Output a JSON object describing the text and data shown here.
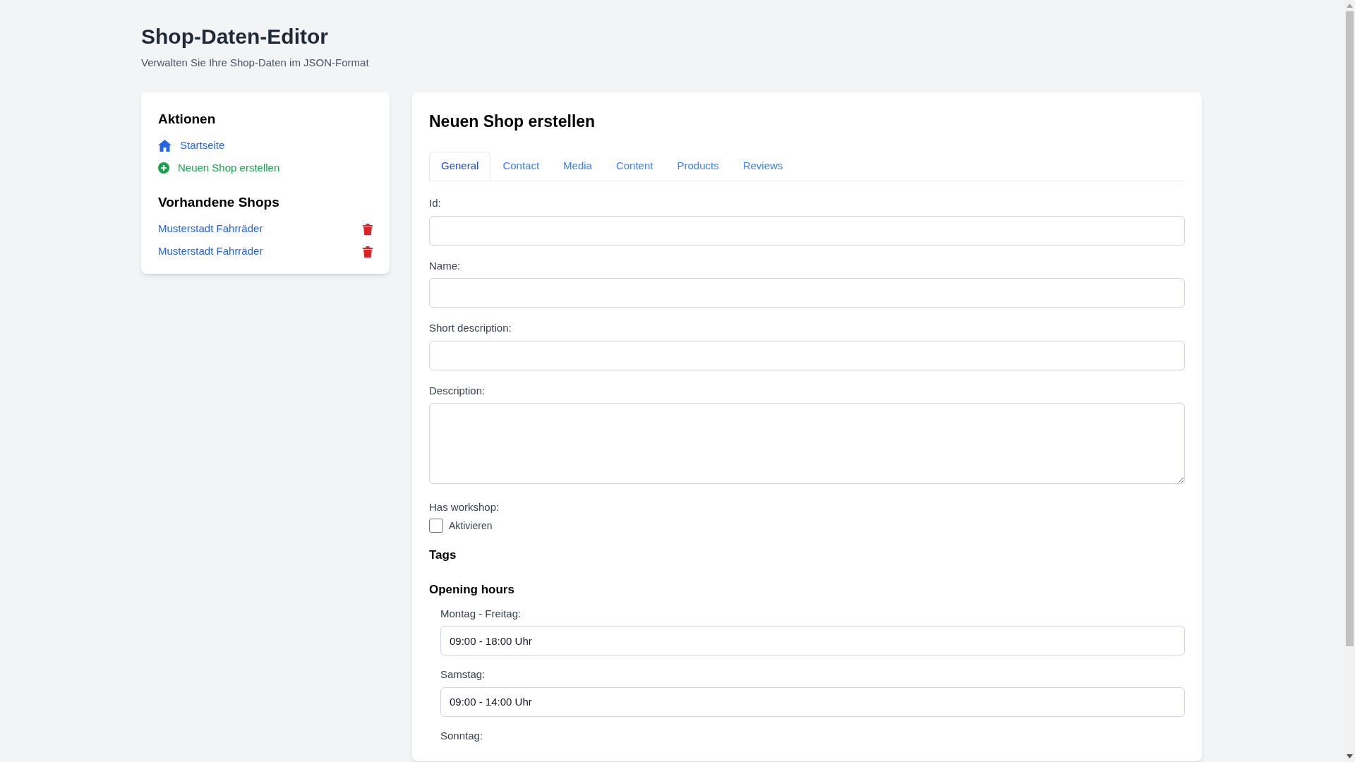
{
  "header": {
    "title": "Shop-Daten-Editor",
    "subtitle": "Verwalten Sie Ihre Shop-Daten im JSON-Format"
  },
  "sidebar": {
    "actions_title": "Aktionen",
    "actions": [
      {
        "kind": "home",
        "label": "Startseite"
      },
      {
        "kind": "create",
        "label": "Neuen Shop erstellen"
      }
    ],
    "shops_title": "Vorhandene Shops",
    "shops": [
      {
        "name": "Musterstadt Fahrräder"
      },
      {
        "name": "Musterstadt Fahrräder"
      }
    ]
  },
  "form": {
    "title": "Neuen Shop erstellen",
    "tabs": [
      {
        "label": "General",
        "selected": true
      },
      {
        "label": "Contact",
        "selected": false
      },
      {
        "label": "Media",
        "selected": false
      },
      {
        "label": "Content",
        "selected": false
      },
      {
        "label": "Products",
        "selected": false
      },
      {
        "label": "Reviews",
        "selected": false
      }
    ],
    "fields": [
      {
        "kind": "text",
        "label": "Id:"
      },
      {
        "kind": "text",
        "label": "Name:"
      },
      {
        "kind": "text",
        "label": "Short description:"
      },
      {
        "kind": "textarea",
        "label": "Description:"
      },
      {
        "kind": "checkbox",
        "label": "Has workshop:",
        "option": "Aktivieren",
        "checked": false
      },
      {
        "kind": "section",
        "label": "Tags"
      },
      {
        "kind": "section",
        "label": "Opening hours"
      },
      {
        "kind": "subtext",
        "label": "Montag - Freitag:",
        "value": "09:00 - 18:00 Uhr"
      },
      {
        "kind": "subtext",
        "label": "Samstag:",
        "value": "09:00 - 14:00 Uhr"
      },
      {
        "kind": "sublabel",
        "label": "Sonntag:"
      }
    ]
  }
}
